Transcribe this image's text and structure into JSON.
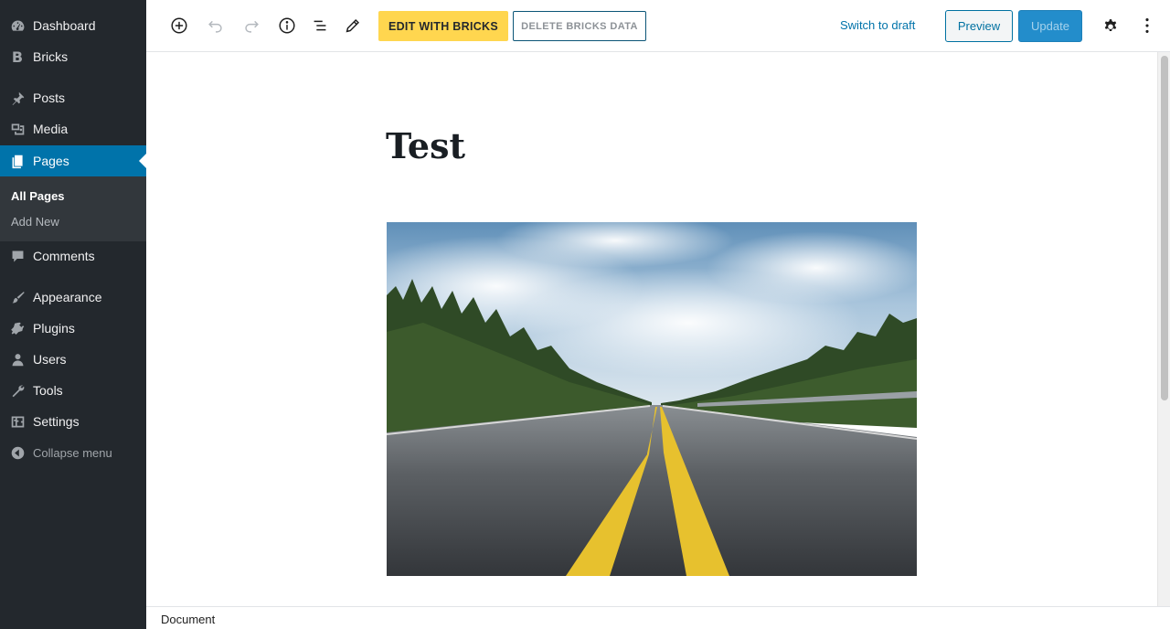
{
  "sidebar": {
    "items": [
      {
        "label": "Dashboard",
        "icon": "dashboard-icon"
      },
      {
        "label": "Bricks",
        "icon": "bricks-icon",
        "glyph": "B"
      },
      {
        "label": "Posts",
        "icon": "pushpin-icon"
      },
      {
        "label": "Media",
        "icon": "media-icon"
      },
      {
        "label": "Pages",
        "icon": "pages-icon",
        "active": true
      },
      {
        "label": "Comments",
        "icon": "comment-icon"
      },
      {
        "label": "Appearance",
        "icon": "paintbrush-icon"
      },
      {
        "label": "Plugins",
        "icon": "plugin-icon"
      },
      {
        "label": "Users",
        "icon": "user-icon"
      },
      {
        "label": "Tools",
        "icon": "wrench-icon"
      },
      {
        "label": "Settings",
        "icon": "settings-icon"
      }
    ],
    "submenu": [
      {
        "label": "All Pages",
        "current": true
      },
      {
        "label": "Add New"
      }
    ],
    "collapse_label": "Collapse menu"
  },
  "toolbar": {
    "icons": [
      "add-block-icon",
      "undo-icon",
      "redo-icon",
      "info-icon",
      "outline-icon",
      "pencil-icon"
    ],
    "edit_bricks_label": "EDIT WITH BRICKS",
    "delete_bricks_label": "DELETE BRICKS DATA",
    "switch_draft_label": "Switch to draft",
    "preview_label": "Preview",
    "update_label": "Update",
    "settings_icon": "gear-icon",
    "more_icon": "vertical-ellipsis-icon"
  },
  "editor": {
    "title": "Test"
  },
  "footer": {
    "breadcrumb": "Document"
  },
  "colors": {
    "sidebar_bg": "#23282d",
    "active_blue": "#0073aa",
    "bricks_yellow": "#ffd64f",
    "update_blue": "#238dcb"
  }
}
